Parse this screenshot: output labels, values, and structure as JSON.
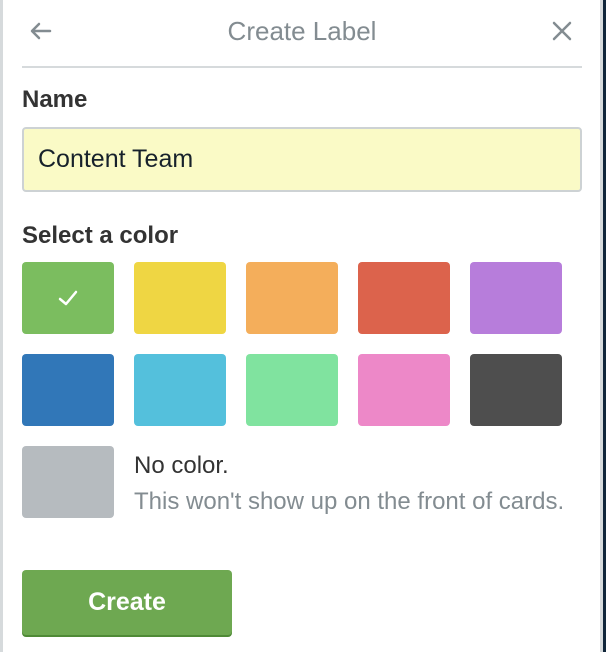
{
  "header": {
    "title": "Create Label",
    "back_icon": "arrow-left-icon",
    "close_icon": "close-icon"
  },
  "name_field": {
    "label": "Name",
    "value": "Content Team",
    "placeholder": ""
  },
  "color_picker": {
    "label": "Select a color",
    "selected": "green",
    "swatches": [
      {
        "name": "green",
        "color": "#7bbd5f",
        "selected": true
      },
      {
        "name": "yellow",
        "color": "#efd643",
        "selected": false
      },
      {
        "name": "orange",
        "color": "#f4ae5b",
        "selected": false
      },
      {
        "name": "red",
        "color": "#dc634c",
        "selected": false
      },
      {
        "name": "purple",
        "color": "#b77ddb",
        "selected": false
      },
      {
        "name": "blue",
        "color": "#3177b8",
        "selected": false
      },
      {
        "name": "sky",
        "color": "#54c0dc",
        "selected": false
      },
      {
        "name": "lime",
        "color": "#80e39f",
        "selected": false
      },
      {
        "name": "pink",
        "color": "#ed88c8",
        "selected": false
      },
      {
        "name": "black",
        "color": "#4e4e4e",
        "selected": false
      }
    ],
    "no_color": {
      "color": "#b6bbbf",
      "title": "No color.",
      "description": "This won't show up on the front of cards."
    }
  },
  "actions": {
    "create_label": "Create"
  }
}
